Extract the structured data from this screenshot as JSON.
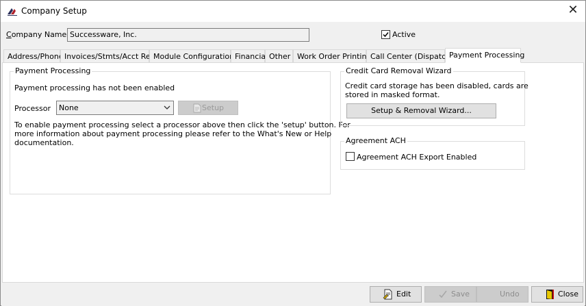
{
  "window": {
    "title": "Company Setup"
  },
  "company": {
    "name_label": "Company Name",
    "name_value": "Successware, Inc."
  },
  "active": {
    "label": "Active",
    "checked": true
  },
  "tabs": [
    {
      "label": "Address/Phone"
    },
    {
      "label": "Invoices/Stmts/Acct Reg"
    },
    {
      "label": "Module Configuration"
    },
    {
      "label": "Financial"
    },
    {
      "label": "Other"
    },
    {
      "label": "Work Order Printing"
    },
    {
      "label": "Call Center (Dispatch)"
    },
    {
      "label": "Payment Processing",
      "active": true
    }
  ],
  "payment_processing": {
    "group_title": "Payment Processing",
    "status": "Payment processing has not been enabled",
    "processor_label": "Processor",
    "processor_value": "None",
    "setup_button": "Setup",
    "help_line1": "To enable payment processing select a processor above then click the 'setup' button. For",
    "help_line2": "more information about payment processing please refer to the What's New or Help",
    "help_line3": "documentation."
  },
  "credit_card_wizard": {
    "group_title": "Credit Card Removal Wizard",
    "text_line1": "Credit card storage has been disabled, cards are",
    "text_line2": "stored in masked format.",
    "button": "Setup & Removal Wizard..."
  },
  "agreement_ach": {
    "group_title": "Agreement ACH",
    "checkbox_label": "Agreement ACH Export Enabled",
    "checked": false
  },
  "footer": {
    "edit": "Edit",
    "save": "Save",
    "undo": "Undo",
    "close": "Close"
  }
}
